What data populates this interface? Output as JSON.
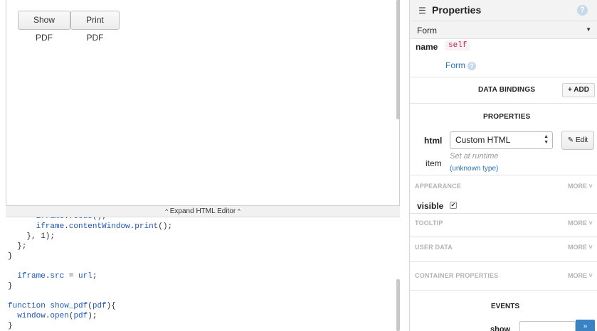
{
  "canvas": {
    "buttons": [
      {
        "label": "Show PDF"
      },
      {
        "label": "Print PDF"
      }
    ]
  },
  "editor": {
    "expand_label": "Expand HTML Editor",
    "lines": [
      {
        "indent": "      ",
        "text": "iframe.focus();"
      },
      {
        "indent": "      ",
        "text": "iframe.contentWindow.print();"
      },
      {
        "indent": "    ",
        "text": "}, 1);"
      },
      {
        "indent": "  ",
        "text": "};"
      },
      {
        "indent": "",
        "text": "}"
      },
      {
        "indent": "",
        "text": ""
      },
      {
        "indent": "  ",
        "text": "iframe.src = url;"
      },
      {
        "indent": "",
        "text": "}"
      },
      {
        "indent": "",
        "text": ""
      },
      {
        "indent": "",
        "text": "function show_pdf(pdf){"
      },
      {
        "indent": "  ",
        "text": "window.open(pdf);"
      },
      {
        "indent": "",
        "text": "}"
      }
    ]
  },
  "panel": {
    "title": "Properties",
    "help_icon": "?",
    "component": "Form",
    "name_label": "name",
    "name_value": "self",
    "type_link": "Form",
    "data_bindings": {
      "title": "DATA BINDINGS",
      "add_label": "+ ADD"
    },
    "properties": {
      "title": "PROPERTIES",
      "html_label": "html",
      "html_value": "Custom HTML",
      "edit_label": "Edit",
      "item_label": "item",
      "item_value": "Set at runtime",
      "item_type": "(unknown type)"
    },
    "appearance": {
      "title": "APPEARANCE",
      "more": "MORE",
      "visible_label": "visible",
      "visible_checked": true
    },
    "tooltip": {
      "title": "TOOLTIP",
      "more": "MORE"
    },
    "user_data": {
      "title": "USER DATA",
      "more": "MORE"
    },
    "container": {
      "title": "CONTAINER PROPERTIES",
      "more": "MORE"
    },
    "events": {
      "title": "EVENTS",
      "show_label": "show",
      "go_label": "»"
    }
  }
}
